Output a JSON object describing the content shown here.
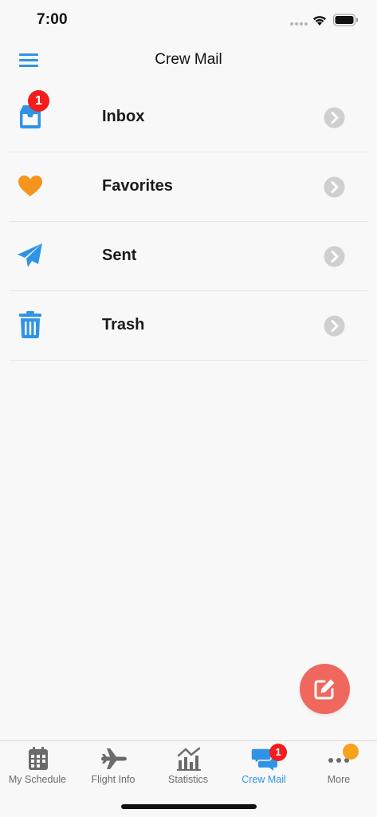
{
  "status_bar": {
    "time": "7:00"
  },
  "nav": {
    "title": "Crew Mail",
    "menu_icon": "hamburger-menu-icon"
  },
  "folders": [
    {
      "label": "Inbox",
      "icon": "inbox-tray-icon",
      "badge": "1",
      "color": "#2f94e6"
    },
    {
      "label": "Favorites",
      "icon": "heart-icon",
      "badge": "",
      "color": "#f7941d"
    },
    {
      "label": "Sent",
      "icon": "paper-plane-icon",
      "badge": "",
      "color": "#2f94e6"
    },
    {
      "label": "Trash",
      "icon": "trash-icon",
      "badge": "",
      "color": "#2f94e6"
    }
  ],
  "compose": {
    "icon": "compose-edit-icon",
    "color": "#f0675e"
  },
  "tabs": [
    {
      "label": "My Schedule",
      "icon": "calendar-icon",
      "active": false
    },
    {
      "label": "Flight Info",
      "icon": "airplane-icon",
      "active": false
    },
    {
      "label": "Statistics",
      "icon": "chart-icon",
      "active": false
    },
    {
      "label": "Crew Mail",
      "icon": "chat-bubbles-icon",
      "active": true,
      "badge": "1"
    },
    {
      "label": "More",
      "icon": "more-dots-icon",
      "active": false
    }
  ],
  "colors": {
    "accent": "#2f94e6",
    "badge": "#f41c1c",
    "inactive": "#6b6b6b",
    "chevron": "#cfcfcf",
    "more_indicator": "#f7a21b"
  }
}
